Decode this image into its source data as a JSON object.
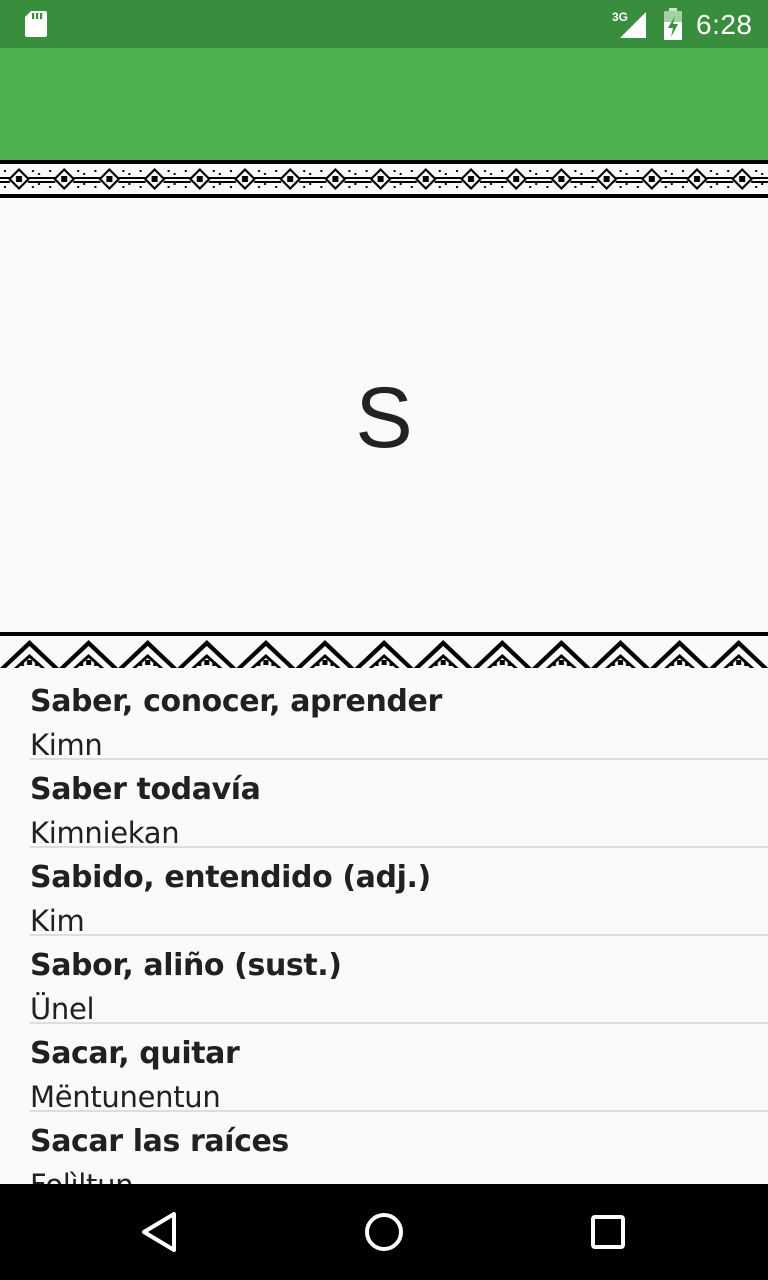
{
  "status_bar": {
    "time": "6:28",
    "network_label": "3G",
    "icons": [
      "sd-card-icon",
      "signal-icon",
      "battery-icon"
    ]
  },
  "app_bar": {
    "color": "#4caf50",
    "status_color": "#388e3c"
  },
  "section": {
    "letter": "S"
  },
  "words": [
    {
      "term": "Saber, conocer, aprender",
      "translation": "Kimn"
    },
    {
      "term": "Saber todavía",
      "translation": "Kimniekan"
    },
    {
      "term": "Sabido, entendido (adj.)",
      "translation": "Kim"
    },
    {
      "term": "Sabor, aliño (sust.)",
      "translation": "Ünel"
    },
    {
      "term": "Sacar, quitar",
      "translation": "Mëntunentun"
    },
    {
      "term": "Sacar las raíces",
      "translation": "Folìltun"
    }
  ],
  "nav_bar": {
    "icons": [
      "back-icon",
      "home-icon",
      "recents-icon"
    ]
  }
}
